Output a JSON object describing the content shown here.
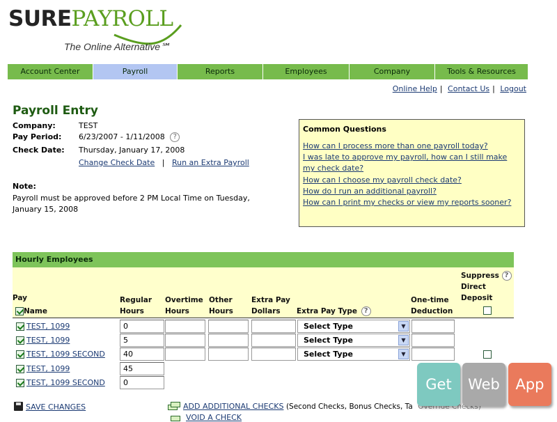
{
  "logo": {
    "sure": "SURE",
    "payroll": "PAYROLL",
    "tagline": "The Online Alternative℠"
  },
  "nav": [
    {
      "label": "Account Center",
      "width": 123,
      "active": false
    },
    {
      "label": "Payroll",
      "width": 121,
      "active": true
    },
    {
      "label": "Reports",
      "width": 123,
      "active": false
    },
    {
      "label": "Employees",
      "width": 124,
      "active": false
    },
    {
      "label": "Company",
      "width": 123,
      "active": false
    },
    {
      "label": "Tools & Resources",
      "width": 134,
      "active": false
    }
  ],
  "util_links": {
    "help": "Online Help",
    "contact": "Contact Us",
    "logout": "Logout"
  },
  "page_title": "Payroll Entry",
  "info": {
    "company_label": "Company:",
    "company_value": "TEST",
    "period_label": "Pay Period:",
    "period_value": "6/23/2007 - 1/11/2008",
    "check_label": "Check Date:",
    "check_value": "Thursday, January 17, 2008",
    "change_date_link": "Change Check Date",
    "extra_payroll_link": "Run an Extra Payroll"
  },
  "note": {
    "label": "Note:",
    "text": "Payroll must be approved before 2 PM Local Time on Tuesday, January 15, 2008"
  },
  "questions": {
    "title": "Common Questions",
    "items": [
      "How can I process more than one payroll today?",
      "I was late to approve my payroll, how can I still make my check date?",
      "How can I choose my payroll check date?",
      "How do I run an additional payroll?",
      "How can I print my checks or view my reports sooner?"
    ]
  },
  "hourly": {
    "title": "Hourly Employees",
    "columns": {
      "pay": "Pay",
      "name": "Name",
      "regular1": "Regular",
      "regular2": "Hours",
      "overtime1": "Overtime",
      "overtime2": "Hours",
      "other1": "Other",
      "other2": "Hours",
      "extra1": "Extra Pay",
      "extra2": "Dollars",
      "extra_type": "Extra Pay Type",
      "deduction1": "One-time",
      "deduction2": "Deduction",
      "suppress1": "Suppress",
      "suppress2": "Direct",
      "suppress3": "Deposit"
    },
    "rows": [
      {
        "name": "TEST, 1099",
        "regular": "0",
        "select": "Select Type",
        "suppress": false
      },
      {
        "name": "TEST, 1099",
        "regular": "5",
        "select": "Select Type",
        "suppress": false
      },
      {
        "name": "TEST, 1099 SECOND",
        "regular": "40",
        "select": "Select Type",
        "suppress": true
      },
      {
        "name": "TEST, 1099",
        "regular": "45"
      },
      {
        "name": "TEST, 1099 SECOND",
        "regular": "0"
      }
    ]
  },
  "actions": {
    "save": "SAVE CHANGES",
    "add_checks": "ADD ADDITIONAL CHECKS",
    "add_checks_note": "(Second Checks, Bonus Checks, Ta",
    "add_checks_note2": "Override Checks)",
    "void_check": "VOID A CHECK"
  },
  "overlay": {
    "get": "Get",
    "web": "Web",
    "app": "App",
    "colors": {
      "get": "#7ec9c0",
      "web": "#a9a9a9",
      "app": "#ea7a5c"
    }
  },
  "colors": {
    "nav": "#77bb4c",
    "nav_active": "#b3c6f2",
    "title": "#1e5b12",
    "panel": "#ffffc4"
  }
}
